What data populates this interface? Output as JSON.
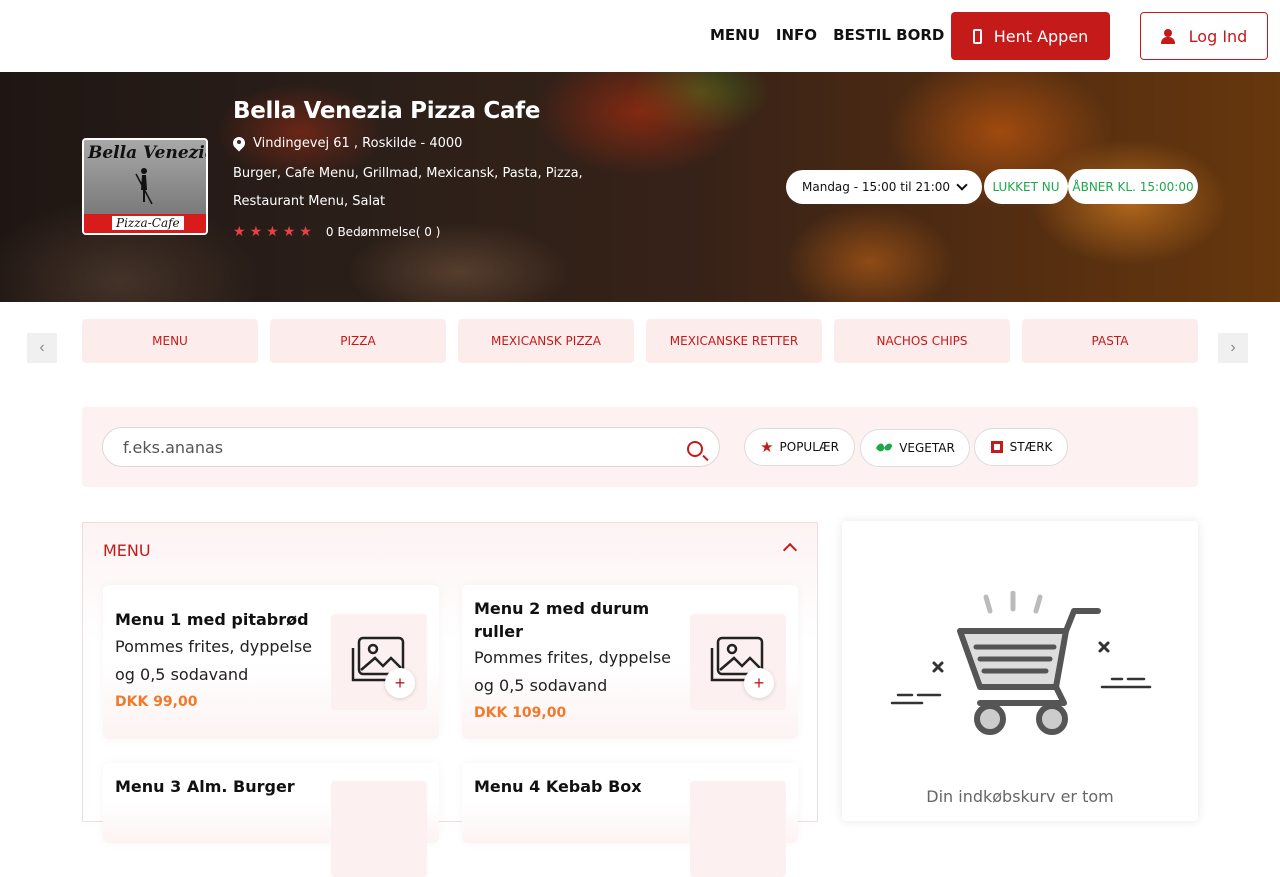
{
  "nav": {
    "links": [
      "MENU",
      "INFO",
      "BESTIL BORD"
    ],
    "app_button": "Hent Appen",
    "login_button": "Log Ind"
  },
  "restaurant": {
    "name": "Bella Venezia Pizza Cafe",
    "address": "Vindingevej 61 , Roskilde - 4000",
    "categories": "Burger, Cafe Menu, Grillmad, Mexicansk, Pasta, Pizza, Restaurant Menu, Salat",
    "rating_count": "0",
    "rating_label": "Bedømmelse( 0 )",
    "logo": {
      "script": "Bella Venezia",
      "cafe": "Pizza-Cafe"
    }
  },
  "hours": {
    "selected": "Mandag - 15:00 til 21:00",
    "status": "LUKKET NU",
    "opens": "ÅBNER KL. 15:00:00"
  },
  "category_tabs": [
    "MENU",
    "PIZZA",
    "MEXICANSK PIZZA",
    "MEXICANSKE RETTER",
    "NACHOS CHIPS",
    "PASTA"
  ],
  "search": {
    "placeholder": "f.eks.ananas"
  },
  "filters": [
    {
      "label": "POPULÆR",
      "icon": "star-icon"
    },
    {
      "label": "VEGETAR",
      "icon": "leaf-icon"
    },
    {
      "label": "STÆRK",
      "icon": "chili-icon"
    }
  ],
  "menu_section": {
    "title": "MENU",
    "items": [
      {
        "title": "Menu 1 med pitabrød",
        "desc": "Pommes frites, dyppelse og 0,5 sodavand",
        "price": "DKK 99,00"
      },
      {
        "title": "Menu 2 med durum ruller",
        "desc": "Pommes frites, dyppelse og 0,5 sodavand",
        "price": "DKK 109,00"
      },
      {
        "title": "Menu 3 Alm. Burger",
        "desc": "",
        "price": ""
      },
      {
        "title": "Menu 4 Kebab Box",
        "desc": "",
        "price": ""
      }
    ]
  },
  "cart": {
    "empty_text": "Din indkøbskurv er tom"
  },
  "colors": {
    "brand_red": "#c41a1a",
    "price_orange": "#f07a2a",
    "open_green": "#1ea84a"
  }
}
